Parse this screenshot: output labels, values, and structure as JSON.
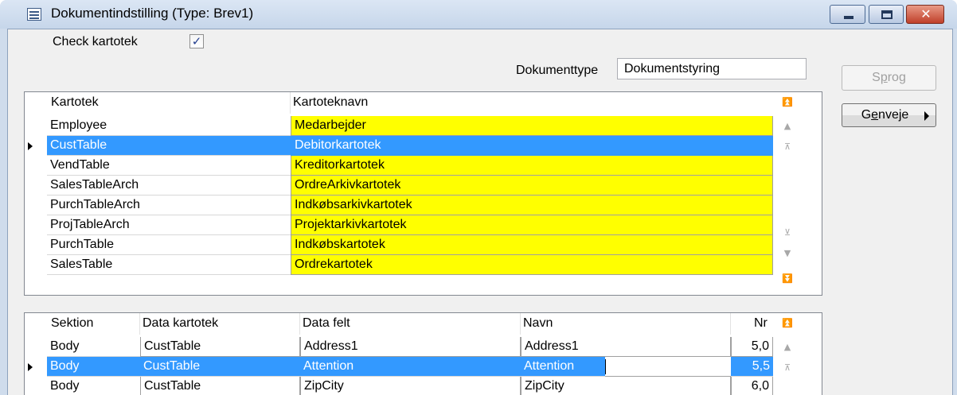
{
  "window": {
    "title": "Dokumentindstilling (Type: Brev1)",
    "icon": "form-icon",
    "controls": [
      "minimize",
      "maximize",
      "close"
    ],
    "close_glyph": "✕"
  },
  "form": {
    "check_kartotek_label": "Check kartotek",
    "check_kartotek_checked": true,
    "checkmark": "✓",
    "dokumenttype_label": "Dokumenttype",
    "dokumenttype_value": "Dokumentstyring"
  },
  "buttons": {
    "sprog_prefix": "S",
    "sprog_mnemonic": "p",
    "sprog_suffix": "rog",
    "genveje_prefix": "G",
    "genveje_mnemonic": "e",
    "genveje_suffix": "nveje"
  },
  "grid1": {
    "headers": [
      "Kartotek",
      "Kartoteknavn"
    ],
    "selected_index": 1,
    "rows": [
      {
        "kartotek": "Employee",
        "navn": "Medarbejder"
      },
      {
        "kartotek": "CustTable",
        "navn": "Debitorkartotek"
      },
      {
        "kartotek": "VendTable",
        "navn": "Kreditorkartotek"
      },
      {
        "kartotek": "SalesTableArch",
        "navn": "OrdreArkivkartotek"
      },
      {
        "kartotek": "PurchTableArch",
        "navn": "Indkøbsarkivkartotek"
      },
      {
        "kartotek": "ProjTableArch",
        "navn": "Projektarkivkartotek"
      },
      {
        "kartotek": "PurchTable",
        "navn": "Indkøbskartotek"
      },
      {
        "kartotek": "SalesTable",
        "navn": "Ordrekartotek"
      }
    ]
  },
  "grid2": {
    "headers": [
      "Sektion",
      "Data kartotek",
      "Data felt",
      "Navn",
      "Nr"
    ],
    "selected_index": 1,
    "rows": [
      {
        "sektion": "Body",
        "data_kartotek": "CustTable",
        "data_felt": "Address1",
        "navn": "Address1",
        "nr": "5,0"
      },
      {
        "sektion": "Body",
        "data_kartotek": "CustTable",
        "data_felt": "Attention",
        "navn": "Attention",
        "nr": "5,5"
      },
      {
        "sektion": "Body",
        "data_kartotek": "CustTable",
        "data_felt": "ZipCity",
        "navn": "ZipCity",
        "nr": "6,0"
      }
    ]
  },
  "navigation": {
    "first": "⏫",
    "prev_page": "▲",
    "prev": "⊼",
    "next": "⊻",
    "next_page": "▼",
    "last": "⏬"
  },
  "colors": {
    "selection": "#3399ff",
    "highlight_field": "#ffff00"
  }
}
